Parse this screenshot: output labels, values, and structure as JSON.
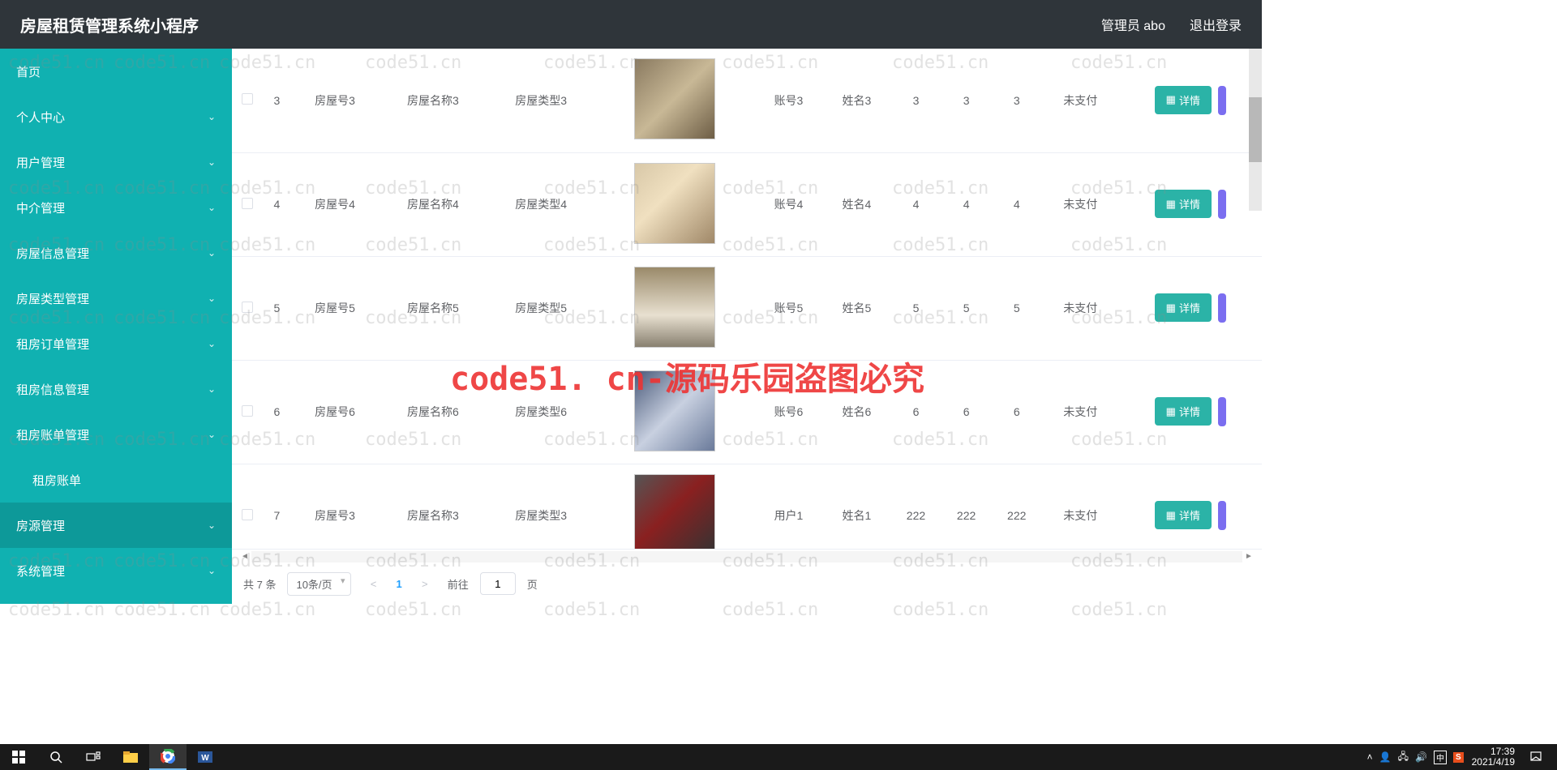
{
  "header": {
    "title": "房屋租赁管理系统小程序",
    "admin_label": "管理员 abo",
    "logout_label": "退出登录"
  },
  "sidebar": {
    "items": [
      {
        "label": "首页",
        "has_children": false
      },
      {
        "label": "个人中心",
        "has_children": true
      },
      {
        "label": "用户管理",
        "has_children": true
      },
      {
        "label": "中介管理",
        "has_children": true
      },
      {
        "label": "房屋信息管理",
        "has_children": true
      },
      {
        "label": "房屋类型管理",
        "has_children": true
      },
      {
        "label": "租房订单管理",
        "has_children": true
      },
      {
        "label": "租房信息管理",
        "has_children": true
      },
      {
        "label": "租房账单管理",
        "has_children": true
      },
      {
        "label": "租房账单",
        "has_children": false,
        "sub": true
      },
      {
        "label": "房源管理",
        "has_children": true,
        "active": true
      },
      {
        "label": "系统管理",
        "has_children": true
      }
    ]
  },
  "table": {
    "rows": [
      {
        "idx": "3",
        "room_no": "房屋号3",
        "room_name": "房屋名称3",
        "room_type": "房屋类型3",
        "account": "账号3",
        "name": "姓名3",
        "c1": "3",
        "c2": "3",
        "c3": "3",
        "pay": "未支付",
        "img": "v1"
      },
      {
        "idx": "4",
        "room_no": "房屋号4",
        "room_name": "房屋名称4",
        "room_type": "房屋类型4",
        "account": "账号4",
        "name": "姓名4",
        "c1": "4",
        "c2": "4",
        "c3": "4",
        "pay": "未支付",
        "img": "v2"
      },
      {
        "idx": "5",
        "room_no": "房屋号5",
        "room_name": "房屋名称5",
        "room_type": "房屋类型5",
        "account": "账号5",
        "name": "姓名5",
        "c1": "5",
        "c2": "5",
        "c3": "5",
        "pay": "未支付",
        "img": "v3"
      },
      {
        "idx": "6",
        "room_no": "房屋号6",
        "room_name": "房屋名称6",
        "room_type": "房屋类型6",
        "account": "账号6",
        "name": "姓名6",
        "c1": "6",
        "c2": "6",
        "c3": "6",
        "pay": "未支付",
        "img": "v4"
      },
      {
        "idx": "7",
        "room_no": "房屋号3",
        "room_name": "房屋名称3",
        "room_type": "房屋类型3",
        "account": "用户1",
        "name": "姓名1",
        "c1": "222",
        "c2": "222",
        "c3": "222",
        "pay": "未支付",
        "img": "v5"
      }
    ],
    "detail_label": "详情"
  },
  "pagination": {
    "total_label": "共 7 条",
    "page_size": "10条/页",
    "current": "1",
    "goto_label": "前往",
    "goto_value": "1",
    "page_suffix": "页"
  },
  "watermark": {
    "small": "code51.cn",
    "big": "code51. cn-源码乐园盗图必究"
  },
  "taskbar": {
    "time": "17:39",
    "date": "2021/4/19",
    "ime": "中",
    "sogou": "S"
  }
}
